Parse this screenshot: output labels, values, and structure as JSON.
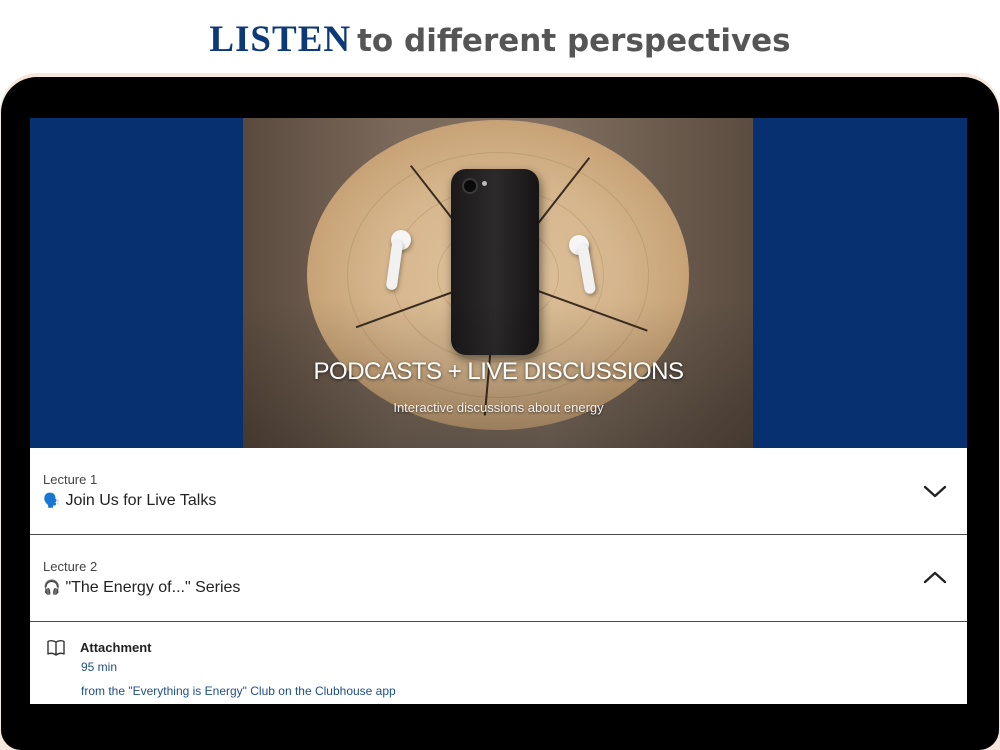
{
  "headline": {
    "emphasis": "LISTEN",
    "rest": "to different perspectives"
  },
  "colors": {
    "brand_navy": "#0c3a76",
    "hero_bg": "#063070",
    "link": "#1e4f86"
  },
  "hero": {
    "title": "PODCASTS + LIVE DISCUSSIONS",
    "subtitle": "Interactive discussions about energy"
  },
  "lectures": [
    {
      "number": "Lecture 1",
      "icon": "speaking-head-emoji",
      "emoji": "🗣️",
      "title": "Join Us for Live Talks",
      "state": "collapsed"
    },
    {
      "number": "Lecture 2",
      "icon": "headphones-emoji",
      "emoji": "🎧",
      "title": "\"The Energy of...\" Series",
      "state": "expanded"
    }
  ],
  "attachment": {
    "icon": "book-icon",
    "label": "Attachment",
    "duration": "95 min",
    "note": "from the \"Everything is Energy\" Club on the Clubhouse app"
  }
}
